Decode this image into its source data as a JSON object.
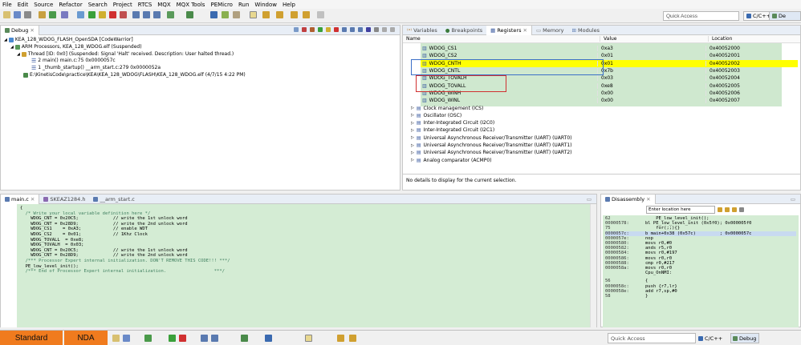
{
  "menu": [
    "File",
    "Edit",
    "Source",
    "Refactor",
    "Search",
    "Project",
    "RTCS",
    "MQX",
    "MQX Tools",
    "PEMicro",
    "Run",
    "Window",
    "Help"
  ],
  "toolbar": {
    "quick_access": "Quick Access",
    "perspective_cpp": "C/C++",
    "perspective_debug": "De"
  },
  "debug_view": {
    "tab": "Debug",
    "items": [
      "KEA_128_WDOG_FLASH_OpenSDA [CodeWarrior]",
      "ARM Processors, KEA_128_WDOG.elf (Suspended)",
      "Thread [ID: 0x0] (Suspended: Signal 'Halt' received. Description: User halted thread.)",
      "2 main() main.c:75 0x0000057c",
      "1 _thumb_startup() __arm_start.c:279 0x0000052a",
      "E:\\KinetisCode\\practice\\KEA\\KEA_128_WDOG\\FLASH\\KEA_128_WDOG.elf (4/7/15 4:22 PM)"
    ]
  },
  "registers_view": {
    "tabs": [
      "Variables",
      "Breakpoints",
      "Registers",
      "Memory",
      "Modules"
    ],
    "headers": {
      "name": "Name",
      "value": "Value",
      "location": "Location"
    },
    "rows": [
      {
        "name": "WDOG_CS1",
        "value": "0xa3",
        "location": "0x40052000"
      },
      {
        "name": "WDOG_CS2",
        "value": "0x01",
        "location": "0x40052001"
      },
      {
        "name": "WDOG_CNTH",
        "value": "0x01",
        "location": "0x40052002"
      },
      {
        "name": "WDOG_CNTL",
        "value": "0x7b",
        "location": "0x40052003"
      },
      {
        "name": "WDOG_TOVALH",
        "value": "0x03",
        "location": "0x40052004"
      },
      {
        "name": "WDOG_TOVALL",
        "value": "0xe8",
        "location": "0x40052005"
      },
      {
        "name": "WDOG_WINH",
        "value": "0x00",
        "location": "0x40052006"
      },
      {
        "name": "WDOG_WINL",
        "value": "0x00",
        "location": "0x40052007"
      }
    ],
    "groups": [
      "Clock management (ICS)",
      "Oscillator (OSC)",
      "Inter-Integrated Circuit (I2C0)",
      "Inter-Integrated Circuit (I2C1)",
      "Universal Asynchronous Receiver/Transmitter (UART) (UART0)",
      "Universal Asynchronous Receiver/Transmitter (UART) (UART1)",
      "Universal Asynchronous Receiver/Transmitter (UART) (UART2)",
      "Analog comparator (ACMP0)"
    ],
    "details": "No details to display for the current selection.",
    "highlight_color": "#ffff00",
    "box_blue": "#3b6fc7",
    "box_red": "#d03030"
  },
  "editor": {
    "tabs": [
      "main.c",
      "SKEAZ1284.h",
      "__arm_start.c"
    ],
    "lines": [
      "{",
      "  /* Write your local variable definition here */",
      "    WDOG_CNT = 0x20C5;             // write the 1st unlock word",
      "    WDOG_CNT = 0x28D9;             // write the 2nd unlock word",
      "",
      "    WDOG_CS1    = 0xA3;            // enable WDT",
      "    WDOG_CS2    = 0x01;            // 1Khz Clock",
      "",
      "    WDOG_TOVALL  = 0xe8;",
      "    WDOG_TOVALH  = 0x03;",
      "",
      "    WDOG_CNT = 0x20C5;             // write the 1st unlock word",
      "    WDOG_CNT = 0x28D9;             // write the 2nd unlock word",
      "",
      "  /*** Processor Expert internal initialization. DON'T REMOVE THIS CODE!!! ***/",
      "  PE_low_level_init();",
      "  /*** End of Processor Expert internal initialization.                  ***/"
    ]
  },
  "disassembly": {
    "tab": "Disassembly",
    "location_placeholder": "Enter location here",
    "lines": [
      {
        "addr": "62",
        "code": "    PE_low_level_init();"
      },
      {
        "addr": "00000578:",
        "code": "bl PE_low_level_init (0x5f0); 0x000005f0"
      },
      {
        "addr": "75",
        "code": "    for(;;){}"
      },
      {
        "addr": "0000057c:",
        "code": "b main+0x38 (0x57c)         ; 0x0000057c"
      },
      {
        "addr": "0000057e:",
        "code": "nop"
      },
      {
        "addr": "00000580:",
        "code": "movs r0,#0"
      },
      {
        "addr": "00000582:",
        "code": "ands r5,r0"
      },
      {
        "addr": "00000584:",
        "code": "movs r0,#197"
      },
      {
        "addr": "00000586:",
        "code": "movs r0,r0"
      },
      {
        "addr": "00000588:",
        "code": "cmp r0,#217"
      },
      {
        "addr": "0000058a:",
        "code": "movs r0,r0"
      },
      {
        "addr": "",
        "code": "Cpu_OnNMI:"
      },
      {
        "addr": "56",
        "code": "{"
      },
      {
        "addr": "0000058c:",
        "code": "push {r7,lr}"
      },
      {
        "addr": "0000058e:",
        "code": "add r7,sp,#0"
      },
      {
        "addr": "58",
        "code": "}"
      }
    ]
  },
  "taskbar": {
    "standard": "Standard",
    "nda": "NDA",
    "quick_access": "Quick Access",
    "cpp": "C/C++",
    "debug": "Debug"
  }
}
